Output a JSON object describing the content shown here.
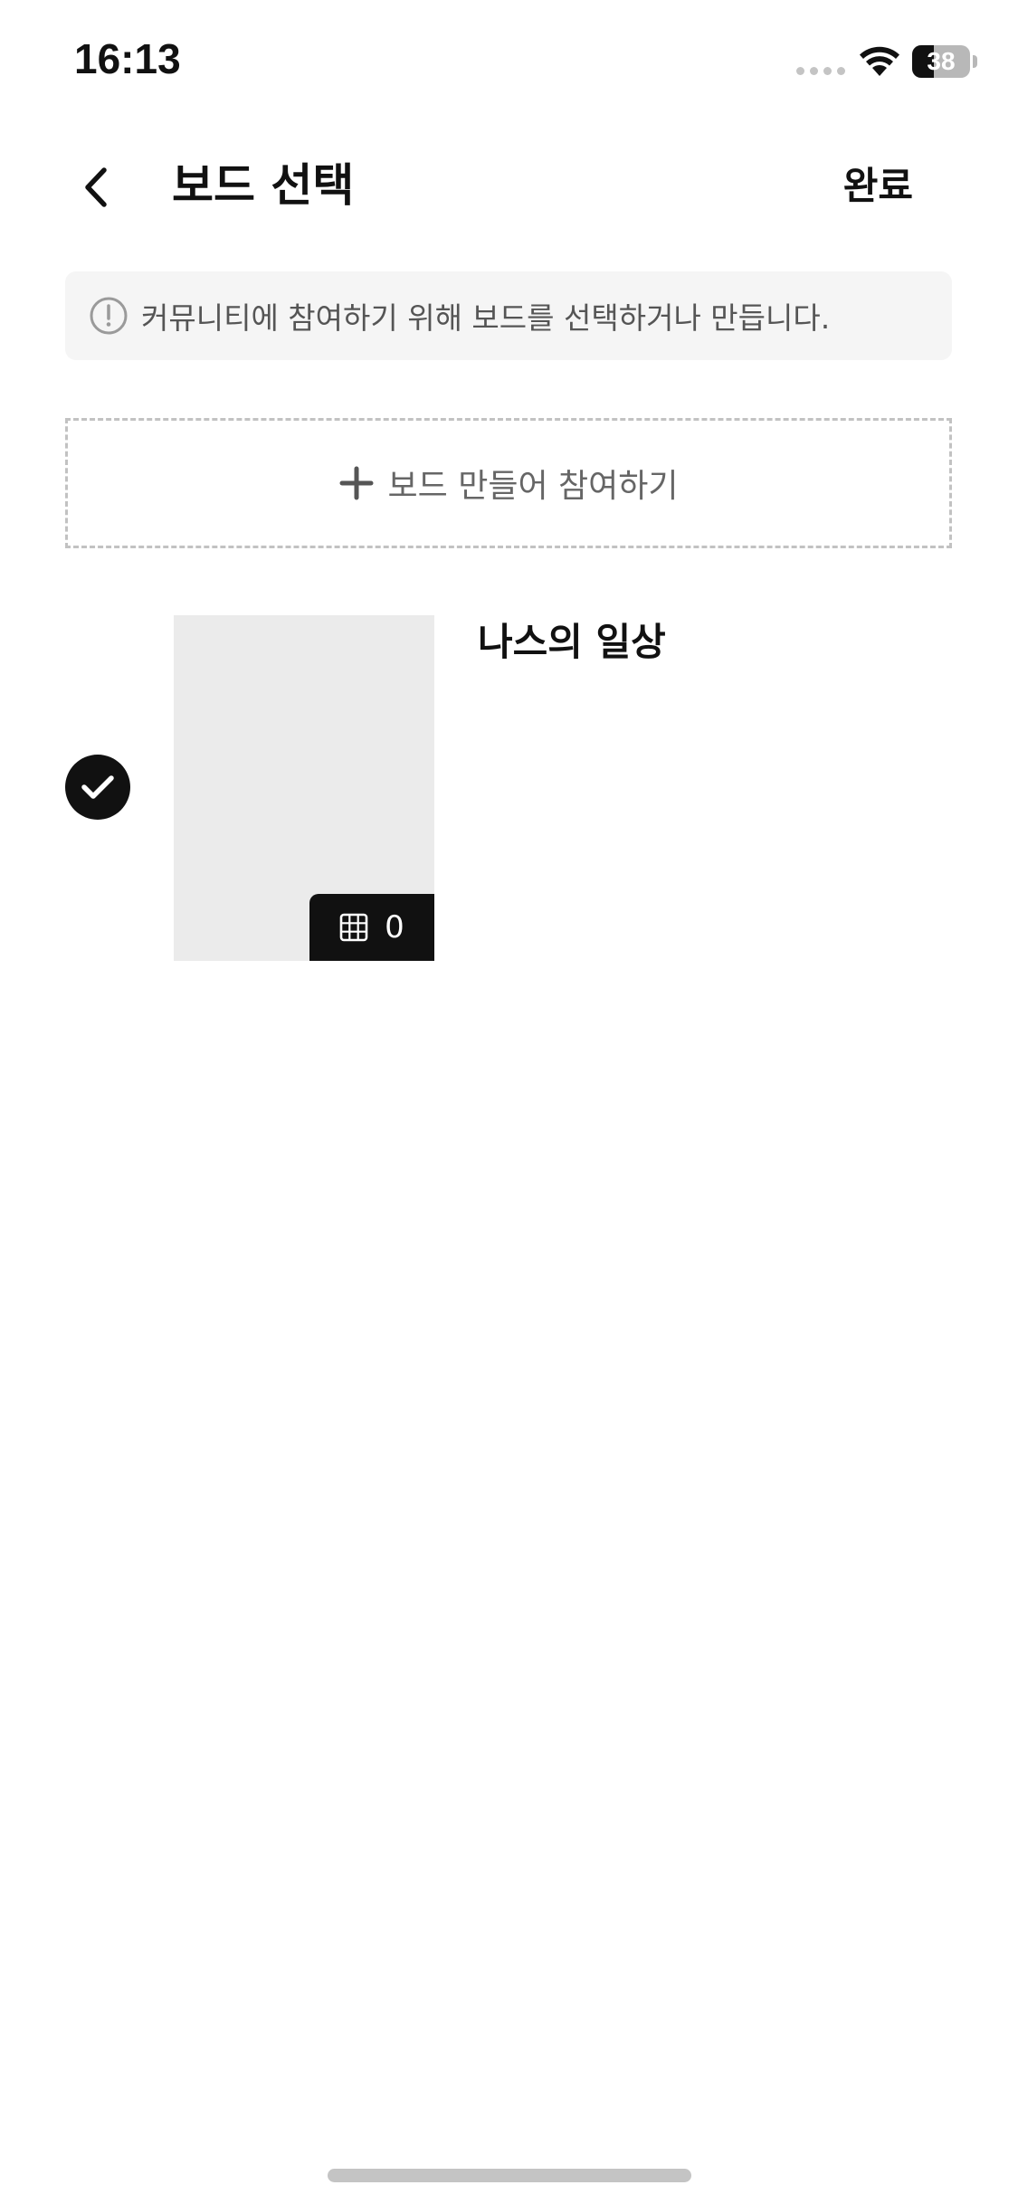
{
  "status_bar": {
    "time": "16:13",
    "battery_level": "38",
    "battery_fraction": 0.38
  },
  "header": {
    "back_icon": "chevron-left-icon",
    "title": "보드 선택",
    "done_label": "완료"
  },
  "info_banner": {
    "icon": "exclamation-circle-icon",
    "text": "커뮤니티에 참여하기 위해 보드를 선택하거나 만듭니다."
  },
  "create_board": {
    "icon": "plus-icon",
    "label": "보드 만들어 참여하기"
  },
  "boards": [
    {
      "name": "나스의 일상",
      "item_count": "0",
      "selected": true,
      "count_icon": "grid-icon"
    }
  ],
  "colors": {
    "text_primary": "#111111",
    "text_secondary": "#555555",
    "banner_bg": "#f5f5f5",
    "thumb_bg": "#ebebeb",
    "dashed_border": "#c2c2c2",
    "accent_dark": "#111111"
  }
}
